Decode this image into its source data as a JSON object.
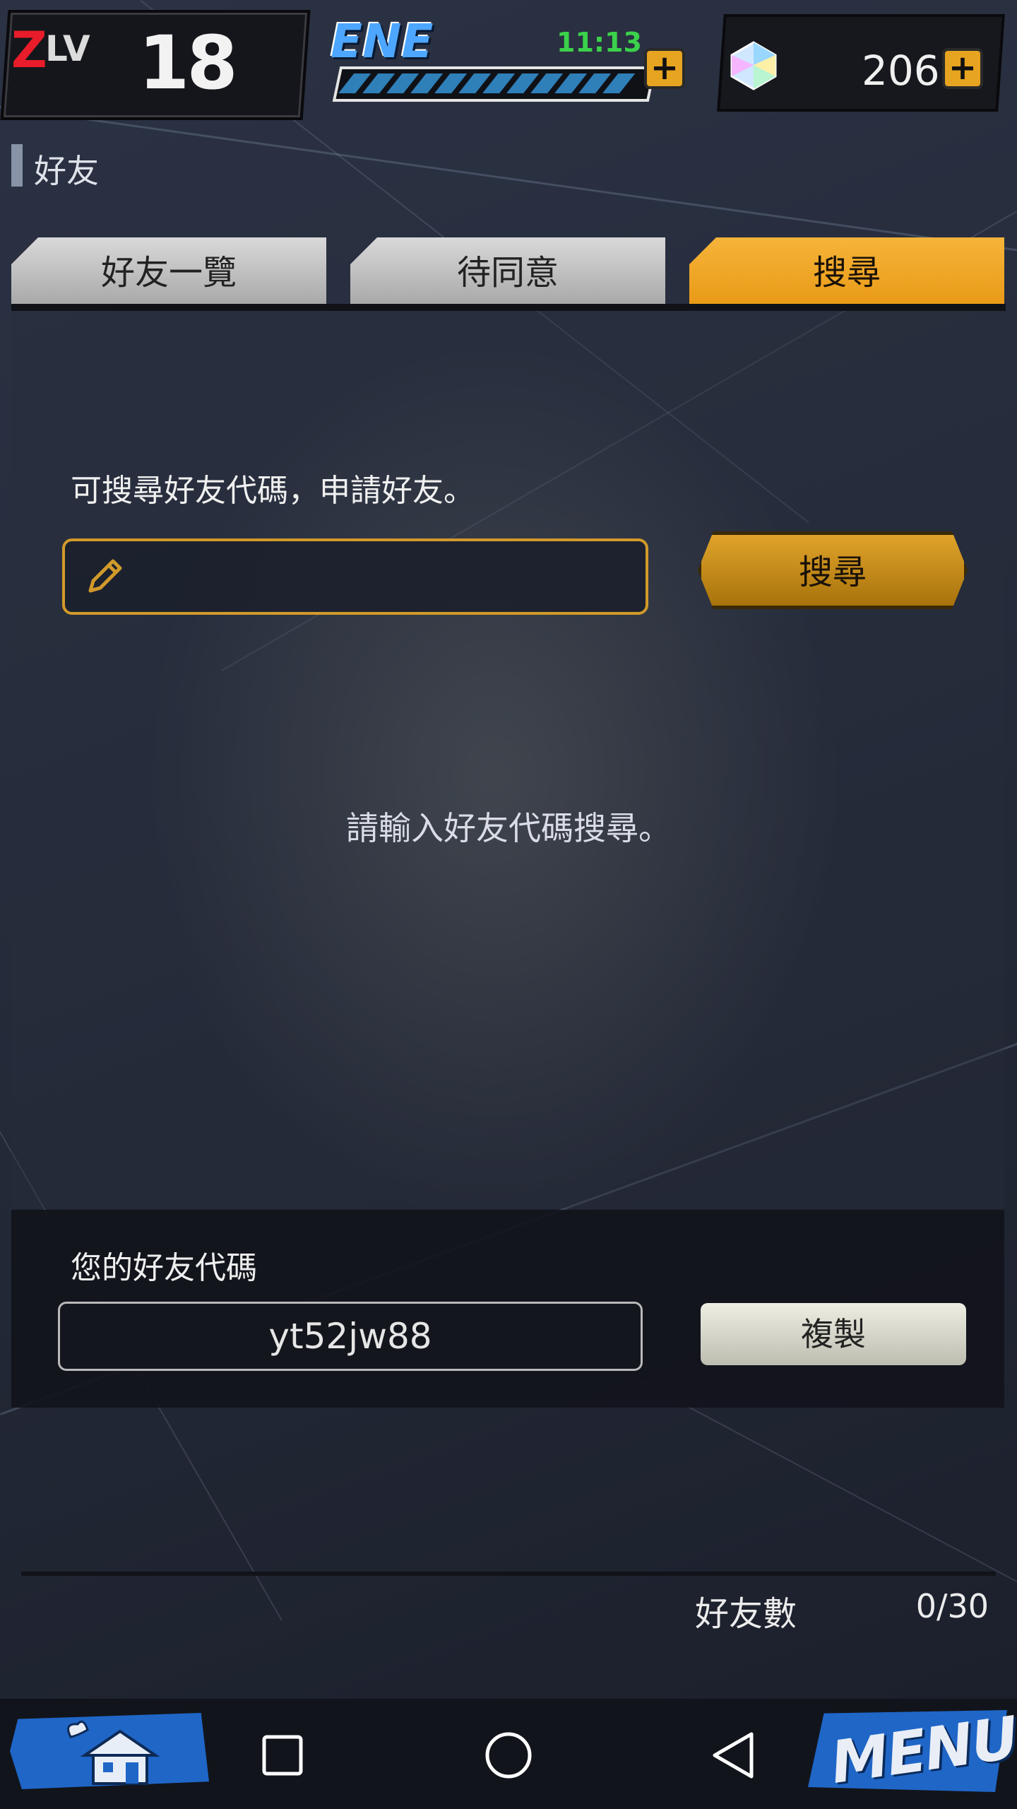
{
  "hud": {
    "level_prefix": "Z",
    "level_label": "LV",
    "level_value": "18",
    "energy_label": "ENE",
    "energy_timer": "11:13",
    "gem_count": "206"
  },
  "page": {
    "title": "好友"
  },
  "tabs": [
    {
      "label": "好友一覽",
      "active": false
    },
    {
      "label": "待同意",
      "active": false
    },
    {
      "label": "搜尋",
      "active": true
    }
  ],
  "search": {
    "instruction": "可搜尋好友代碼，申請好友。",
    "input_value": "",
    "button_label": "搜尋",
    "empty_message": "請輸入好友代碼搜尋。"
  },
  "friend_code": {
    "label": "您的好友代碼",
    "value": "yt52jw88",
    "copy_label": "複製"
  },
  "friend_count": {
    "label": "好友數",
    "value": "0/30"
  },
  "nav": {
    "menu_label": "MENU",
    "home_icon": "house-icon",
    "system_buttons": [
      "square-icon",
      "circle-icon",
      "back-triangle-icon"
    ]
  },
  "colors": {
    "tab_active": "#f0a826",
    "tab_inactive": "#c4c4c4",
    "accent_gold": "#d19a2a",
    "energy_blue": "#4da6ff",
    "timer_green": "#3bd14b",
    "nav_blue": "#1f66c7",
    "level_red": "#e81c2a"
  }
}
